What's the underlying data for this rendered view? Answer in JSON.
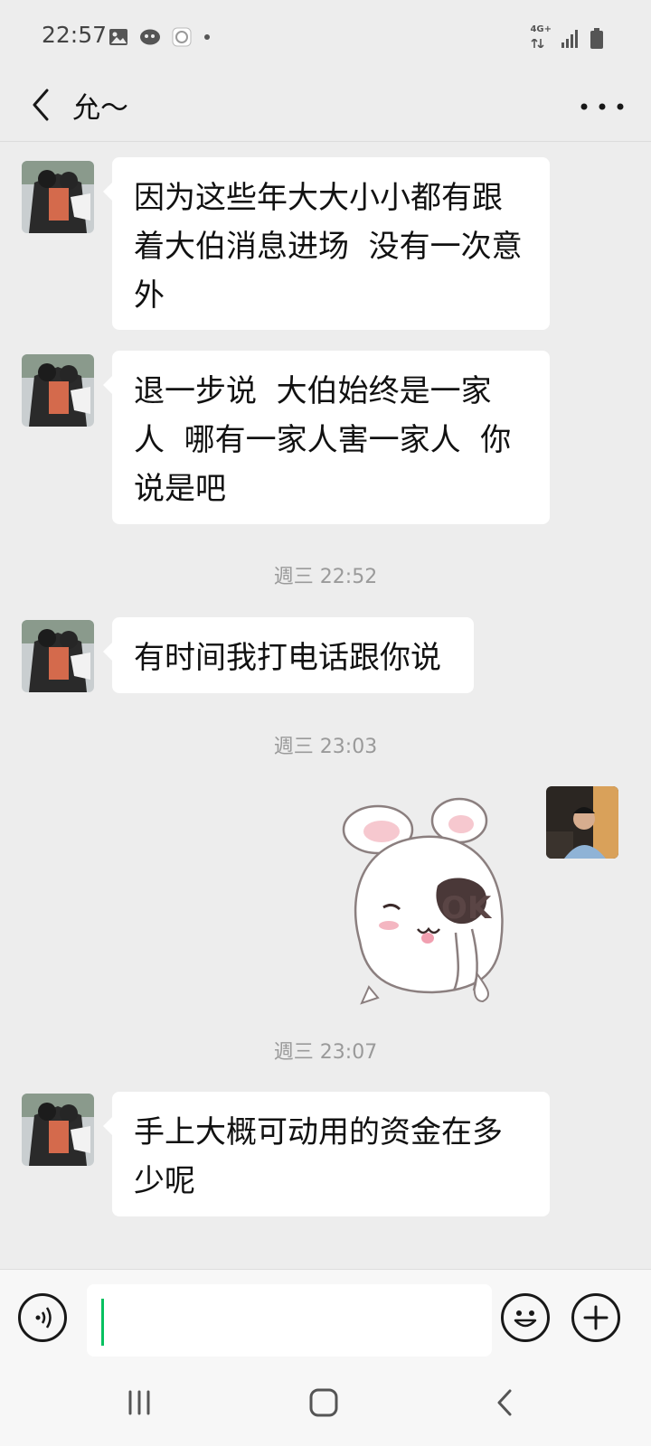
{
  "status_bar": {
    "time": "22:57",
    "network": "4G+",
    "icons": [
      "image-icon",
      "chat-bubble-icon",
      "app-icon",
      "dot-icon",
      "signal-icon",
      "battery-icon"
    ]
  },
  "header": {
    "back_icon": "back-arrow-icon",
    "title": "允～",
    "more_icon": "more-icon"
  },
  "messages": [
    {
      "type": "text",
      "from": "contact",
      "text": "因为这些年大大小小都有跟\n着大伯消息进场  没有一次意\n外"
    },
    {
      "type": "text",
      "from": "contact",
      "text": "退一步说  大伯始终是一家\n人  哪有一家人害一家人  你\n说是吧"
    },
    {
      "type": "time",
      "text": "週三 22:52"
    },
    {
      "type": "text",
      "from": "contact",
      "text": "有时间我打电话跟你说"
    },
    {
      "type": "time",
      "text": "週三 23:03"
    },
    {
      "type": "sticker",
      "from": "me",
      "description": "bunny-ok-sticker"
    },
    {
      "type": "time",
      "text": "週三 23:07"
    },
    {
      "type": "text",
      "from": "contact",
      "text": "手上大概可动用的资金在多\n少呢"
    }
  ],
  "input_bar": {
    "voice_icon": "voice-icon",
    "text_value": "",
    "emoji_icon": "emoji-icon",
    "plus_icon": "plus-icon"
  },
  "nav_bar": {
    "icons": [
      "recent-apps-icon",
      "home-icon",
      "back-icon"
    ]
  },
  "colors": {
    "background": "#ededed",
    "bubble": "#ffffff",
    "caret": "#07c160",
    "timestamp": "#9a9a9a"
  }
}
